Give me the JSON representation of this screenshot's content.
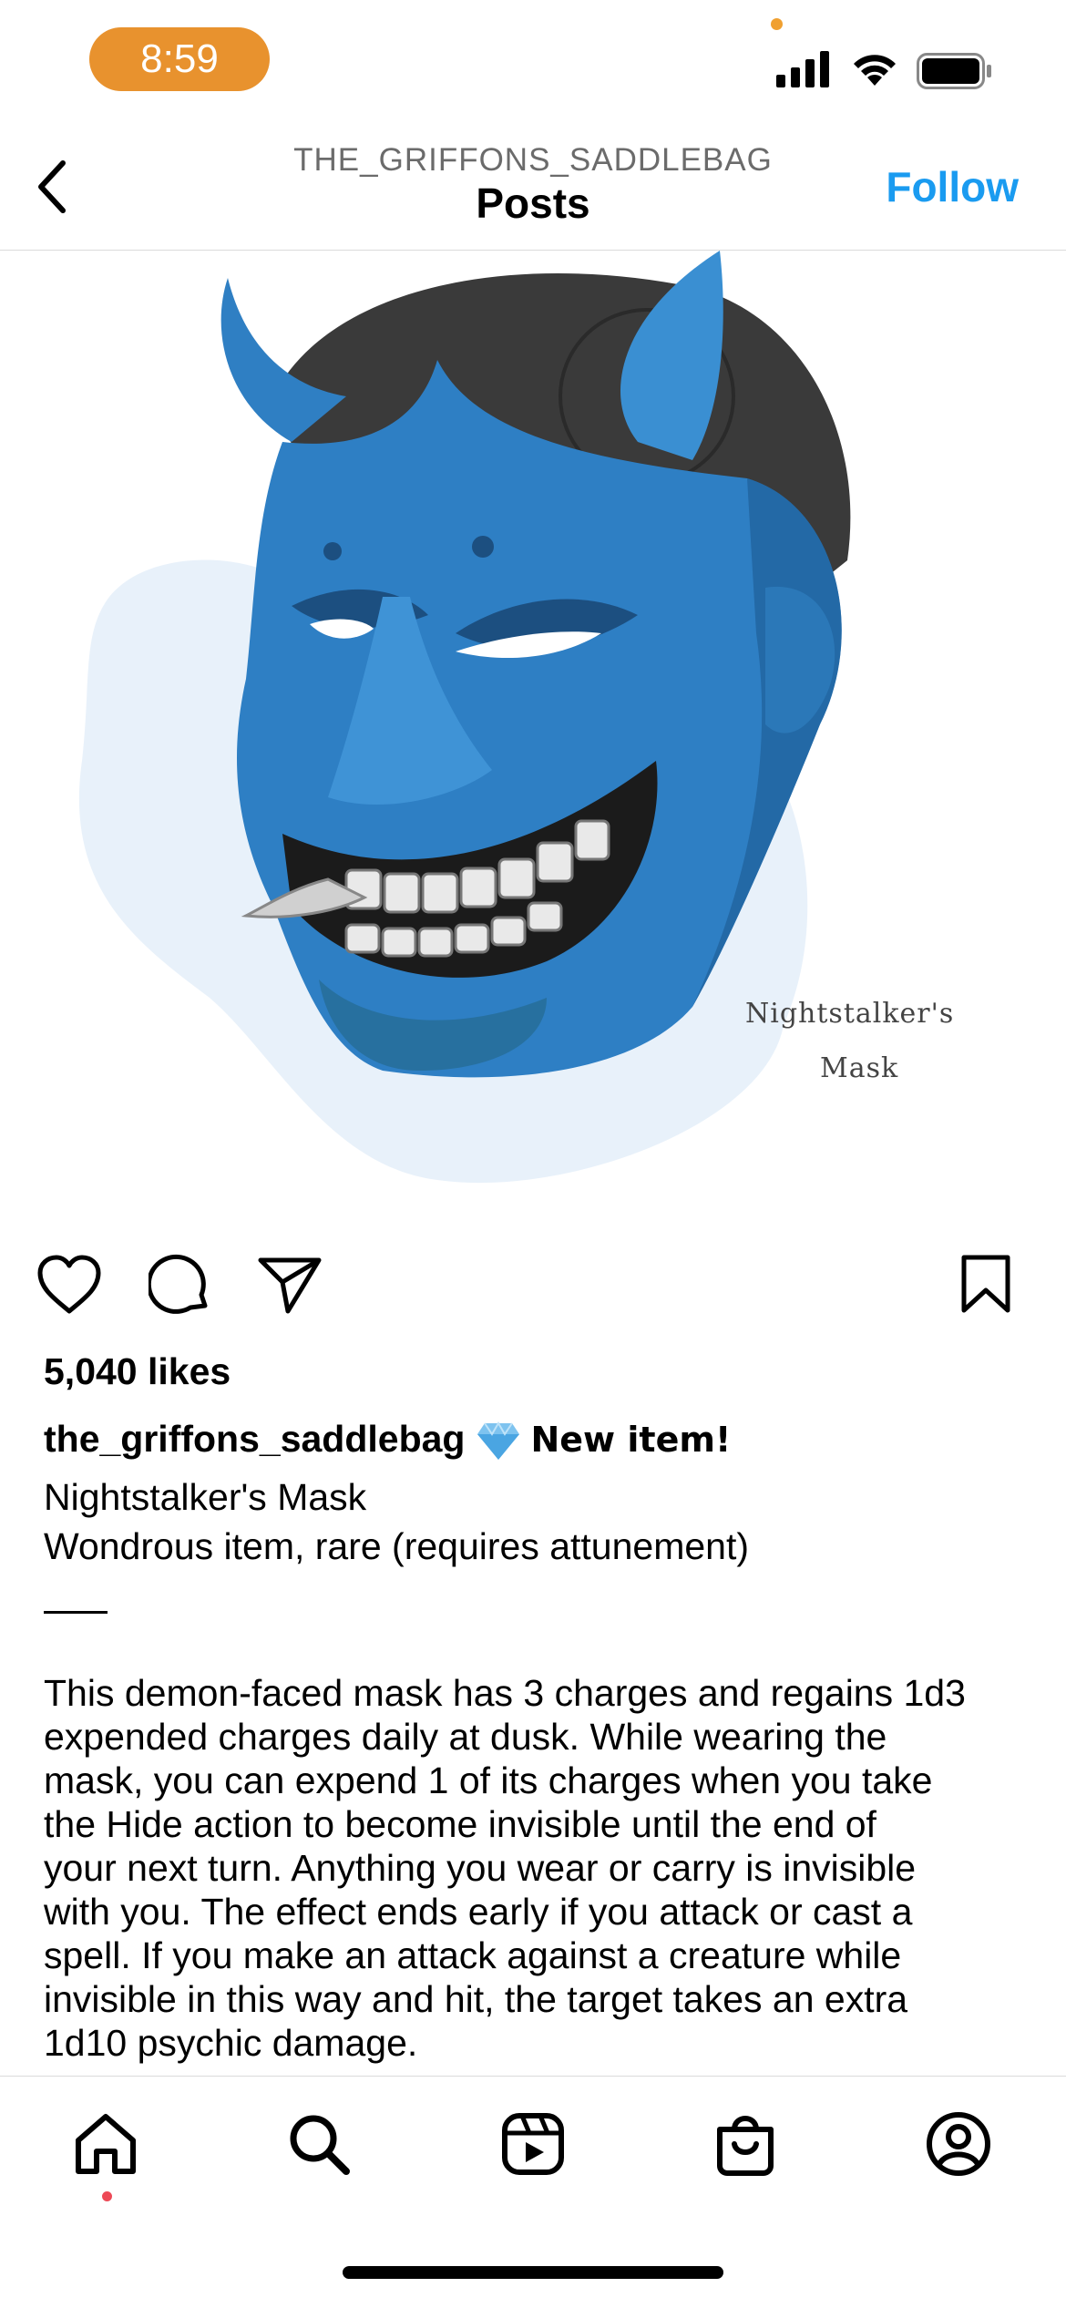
{
  "status_bar": {
    "time": "8:59",
    "icons": [
      "signal-icon",
      "wifi-icon",
      "battery-icon"
    ]
  },
  "header": {
    "account": "THE_GRIFFONS_SADDLEBAG",
    "title": "Posts",
    "follow_label": "Follow",
    "back_icon": "chevron-left-icon"
  },
  "post_image": {
    "art_caption_line1": "Nightstalker's",
    "art_caption_line2": "Mask"
  },
  "actions": {
    "icons": [
      "heart-icon",
      "comment-icon",
      "share-icon",
      "bookmark-icon"
    ]
  },
  "post": {
    "likes": "5,040 likes",
    "username": "the_griffons_saddlebag",
    "badge_icon": "gem-icon",
    "headline": "New item!",
    "item_name": "Nightstalker's Mask",
    "item_type": "Wondrous item, rare (requires attunement)",
    "description": "This demon-faced mask has 3 charges and regains 1d3\nexpended charges daily at dusk. While wearing the\nmask, you can expend 1 of its charges when you take\nthe Hide action to become invisible until the end of\nyour next turn. Anything you wear or carry is invisible\nwith you. The effect ends early if you attack or cast a\nspell. If you make an attack against a creature while\ninvisible in this way and hit, the target takes an extra\n1d10 psychic damage."
  },
  "bottom_nav": {
    "items": [
      "home-icon",
      "search-icon",
      "reels-icon",
      "shop-icon",
      "profile-icon"
    ]
  },
  "colors": {
    "time_pill": "#e8922e",
    "follow": "#1a9bf0",
    "mask_blue": "#2e7fc4",
    "notification_dot": "#ed4956"
  }
}
